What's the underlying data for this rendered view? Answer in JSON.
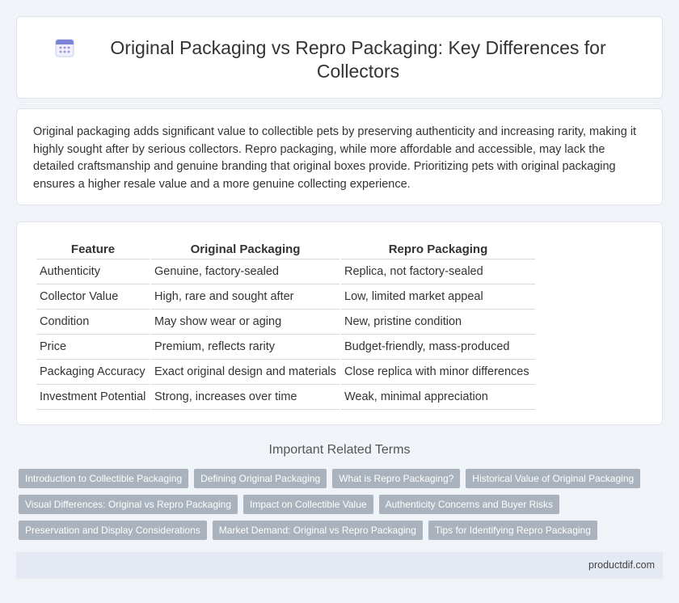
{
  "header": {
    "icon": "calendar-icon",
    "title": "Original Packaging vs Repro Packaging: Key Differences for Collectors"
  },
  "intro": {
    "text": "Original packaging adds significant value to collectible pets by preserving authenticity and increasing rarity, making it highly sought after by serious collectors. Repro packaging, while more affordable and accessible, may lack the detailed craftsmanship and genuine branding that original boxes provide. Prioritizing pets with original packaging ensures a higher resale value and a more genuine collecting experience."
  },
  "table": {
    "headers": [
      "Feature",
      "Original Packaging",
      "Repro Packaging"
    ],
    "rows": [
      [
        "Authenticity",
        "Genuine, factory-sealed",
        "Replica, not factory-sealed"
      ],
      [
        "Collector Value",
        "High, rare and sought after",
        "Low, limited market appeal"
      ],
      [
        "Condition",
        "May show wear or aging",
        "New, pristine condition"
      ],
      [
        "Price",
        "Premium, reflects rarity",
        "Budget-friendly, mass-produced"
      ],
      [
        "Packaging Accuracy",
        "Exact original design and materials",
        "Close replica with minor differences"
      ],
      [
        "Investment Potential",
        "Strong, increases over time",
        "Weak, minimal appreciation"
      ]
    ]
  },
  "related": {
    "title": "Important Related Terms",
    "tags": [
      "Introduction to Collectible Packaging",
      "Defining Original Packaging",
      "What is Repro Packaging?",
      "Historical Value of Original Packaging",
      "Visual Differences: Original vs Repro Packaging",
      "Impact on Collectible Value",
      "Authenticity Concerns and Buyer Risks",
      "Preservation and Display Considerations",
      "Market Demand: Original vs Repro Packaging",
      "Tips for Identifying Repro Packaging"
    ]
  },
  "footer": {
    "site": "productdif.com"
  }
}
